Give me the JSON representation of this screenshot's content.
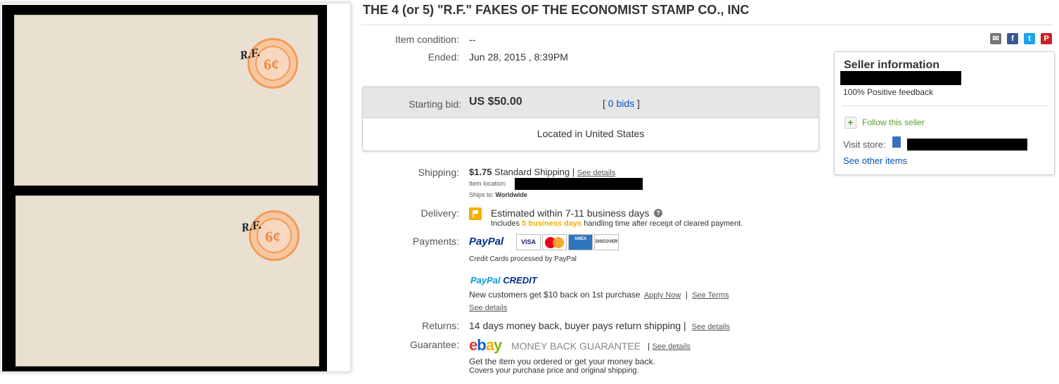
{
  "title": "THE 4 (or 5) \"R.F.\" FAKES OF THE ECONOMIST STAMP CO., INC",
  "photo": {
    "stamp_denomination": "6¢",
    "stamp_overprint": "R.F."
  },
  "condition": {
    "label": "Item condition:",
    "value": "--"
  },
  "ended": {
    "label": "Ended:",
    "value": "Jun 28, 2015 , 8:39PM"
  },
  "bid": {
    "label": "Starting bid:",
    "price": "US $50.00",
    "bids_open": "[",
    "bids_link": "0 bids",
    "bids_close": "]",
    "location": "Located in United States"
  },
  "shipping": {
    "label": "Shipping:",
    "price": "$1.75",
    "service": "Standard Shipping |",
    "details_link": "See details",
    "item_location_label": "Item location:",
    "ships_to_label": "Ships to:",
    "ships_to_value": "Worldwide"
  },
  "delivery": {
    "label": "Delivery:",
    "estimate": "Estimated within 7-11 business days",
    "help_icon": "?",
    "includes": "Includes",
    "handling": "5 business days",
    "handling_rest": "handling time after receipt of cleared payment."
  },
  "payments": {
    "label": "Payments:",
    "paypal": "PayPal",
    "cards": [
      "VISA",
      "MC",
      "AMEX",
      "DISCOVER"
    ],
    "cards_note": "Credit Cards processed by PayPal",
    "credit_logo_a": "PayPal",
    "credit_logo_b": "CREDIT",
    "credit_text": "New customers get $10 back on 1st purchase",
    "apply_link": "Apply Now",
    "sep": "|",
    "terms_link": "See Terms",
    "details_link": "See details"
  },
  "returns": {
    "label": "Returns:",
    "value": "14 days money back, buyer pays return shipping |",
    "details_link": "See details"
  },
  "guarantee": {
    "label": "Guarantee:",
    "brand": [
      "e",
      "b",
      "a",
      "y"
    ],
    "mbg": "MONEY BACK GUARANTEE",
    "sep": "|",
    "details_link": "See details",
    "line1": "Get the item you ordered or get your money back.",
    "line2": "Covers your purchase price and original shipping."
  },
  "seller": {
    "heading": "Seller information",
    "feedback": "100% Positive feedback",
    "follow": "Follow this seller",
    "follow_icon": "+",
    "visit_store": "Visit store:",
    "other_items": "See other items"
  },
  "share": {
    "email": "✉",
    "facebook": "f",
    "twitter": "t",
    "pinterest": "P"
  },
  "colors": {
    "link": "#0654ba",
    "orange": "#f5af02",
    "follow_green": "#5a9e2f"
  }
}
